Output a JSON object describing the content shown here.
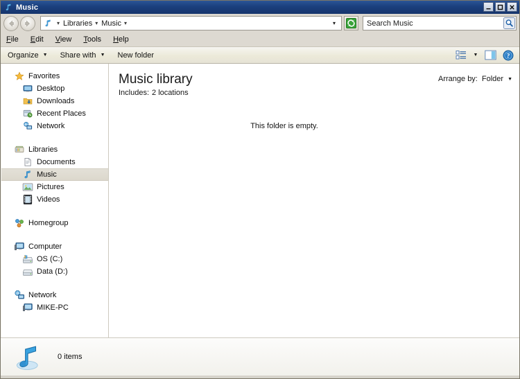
{
  "window": {
    "title": "Music",
    "title_icon": "music-note-icon",
    "controls": {
      "minimize": "–",
      "maximize": "❐",
      "close": "✕"
    }
  },
  "address": {
    "back_icon": "back-arrow-icon",
    "forward_icon": "forward-arrow-icon",
    "location_icon": "music-note-icon",
    "separator": "▾",
    "crumbs": [
      "Libraries",
      "Music"
    ],
    "history_dropdown": "▾",
    "refresh_icon": "refresh-icon"
  },
  "search": {
    "value": "Search Music",
    "placeholder": "Search Music",
    "icon": "search-icon"
  },
  "menubar": {
    "items": [
      {
        "label": "File",
        "accel": "F",
        "rest": "ile"
      },
      {
        "label": "Edit",
        "accel": "E",
        "rest": "dit"
      },
      {
        "label": "View",
        "accel": "V",
        "rest": "iew"
      },
      {
        "label": "Tools",
        "accel": "T",
        "rest": "ools"
      },
      {
        "label": "Help",
        "accel": "H",
        "rest": "elp"
      }
    ]
  },
  "toolbar": {
    "organize_label": "Organize",
    "share_label": "Share with",
    "newfolder_label": "New folder",
    "caret": "▼",
    "view_icon": "view-list-icon",
    "view_caret": "▼",
    "preview_icon": "preview-pane-icon",
    "help_icon": "help-icon"
  },
  "sidebar": {
    "groups": [
      {
        "header": {
          "label": "Favorites",
          "icon": "star-icon"
        },
        "items": [
          {
            "label": "Desktop",
            "icon": "desktop-icon"
          },
          {
            "label": "Downloads",
            "icon": "downloads-folder-icon"
          },
          {
            "label": "Recent Places",
            "icon": "recent-places-icon"
          },
          {
            "label": "Network",
            "icon": "network-icon"
          }
        ]
      },
      {
        "header": {
          "label": "Libraries",
          "icon": "libraries-icon"
        },
        "items": [
          {
            "label": "Documents",
            "icon": "documents-icon",
            "selected": false
          },
          {
            "label": "Music",
            "icon": "music-note-icon",
            "selected": true
          },
          {
            "label": "Pictures",
            "icon": "pictures-icon",
            "selected": false
          },
          {
            "label": "Videos",
            "icon": "videos-icon",
            "selected": false
          }
        ]
      },
      {
        "header": {
          "label": "Homegroup",
          "icon": "homegroup-icon"
        },
        "items": []
      },
      {
        "header": {
          "label": "Computer",
          "icon": "computer-icon"
        },
        "items": [
          {
            "label": "OS (C:)",
            "icon": "system-drive-icon"
          },
          {
            "label": "Data (D:)",
            "icon": "drive-icon"
          }
        ]
      },
      {
        "header": {
          "label": "Network",
          "icon": "network-icon"
        },
        "items": [
          {
            "label": "MIKE-PC",
            "icon": "computer-icon"
          }
        ]
      }
    ]
  },
  "content": {
    "library_title": "Music library",
    "includes_label": "Includes:",
    "includes_value": "2 locations",
    "arrange_label": "Arrange by:",
    "arrange_value": "Folder",
    "arrange_caret": "▼",
    "empty_message": "This folder is empty."
  },
  "statusbar": {
    "icon": "music-note-icon",
    "item_count": "0 items"
  },
  "colors": {
    "titlebar": "#1b3f7d",
    "toolbar": "#ecead9",
    "chrome": "#ddd9d1",
    "selection": "#e0ddd3",
    "accent_blue": "#1a8fd0"
  }
}
